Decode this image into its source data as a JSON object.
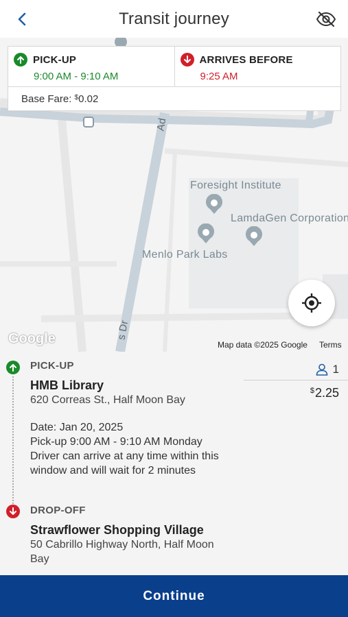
{
  "header": {
    "title": "Transit journey",
    "back_icon": "chevron-left-icon",
    "hide_icon": "eye-off-icon"
  },
  "map": {
    "labels": {
      "foresight": "Foresight Institute",
      "lamdagen": "LamdaGen Corporation",
      "menlo": "Menlo Park Labs",
      "street_ad": "Ad",
      "street_sdr": "s Dr"
    },
    "google_logo": "Google",
    "attribution": "Map data ©2025 Google",
    "terms": "Terms"
  },
  "summary": {
    "pickup_label": "PICK-UP",
    "pickup_time": "9:00 AM - 9:10 AM",
    "arrives_label": "ARRIVES BEFORE",
    "arrives_time": "9:25 AM",
    "fare_label": "Base Fare: ",
    "fare_currency": "$",
    "fare_amount": "0.02"
  },
  "trip": {
    "pickup": {
      "label": "PICK-UP",
      "name": "HMB Library",
      "address": "620 Correas St., Half Moon Bay",
      "date": "Date: Jan 20, 2025",
      "window": "Pick-up 9:00 AM - 9:10 AM Monday",
      "note": "Driver can arrive at any time within this window and will wait for 2 minutes"
    },
    "dropoff": {
      "label": "DROP-OFF",
      "name": "Strawflower Shopping Village",
      "address": "50 Cabrillo Highway North, Half Moon Bay"
    },
    "riders": "1",
    "price_currency": "$",
    "price_amount": "2.25"
  },
  "footer": {
    "continue_label": "Continue"
  },
  "colors": {
    "green": "#1a8a2a",
    "red": "#d0202a",
    "primary": "#0a3f8c"
  }
}
